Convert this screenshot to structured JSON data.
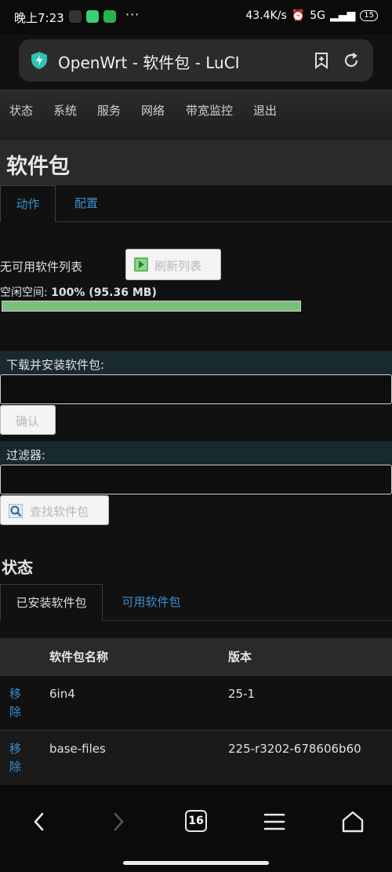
{
  "statusbar": {
    "time": "晚上7:23",
    "dots": "···",
    "net_speed": "43.4K/s",
    "signal": "5G",
    "battery": "15"
  },
  "browser": {
    "title": "OpenWrt - 软件包 - LuCI",
    "tab_count": "16"
  },
  "nav": {
    "items": [
      "状态",
      "系统",
      "服务",
      "网络",
      "带宽监控",
      "退出"
    ]
  },
  "page": {
    "title": "软件包",
    "tabs": [
      "动作",
      "配置"
    ]
  },
  "actions": {
    "list_label": "无可用软件列表",
    "refresh_button": "刷新列表",
    "free_space_label": "空闲空间:",
    "free_space_value": "100% (95.36 MB)",
    "free_space_percent": 100,
    "install_label": "下载并安装软件包:",
    "install_value": "",
    "confirm_button": "确认",
    "filter_label": "过滤器:",
    "filter_value": "",
    "find_button": "查找软件包"
  },
  "status": {
    "title": "状态",
    "tabs": [
      "已安装软件包",
      "可用软件包"
    ],
    "columns": [
      "软件包名称",
      "版本"
    ],
    "remove_label": "移除",
    "rows": [
      {
        "name": "6in4",
        "version": "25-1"
      },
      {
        "name": "base-files",
        "version": "225-r3202-678606b60"
      }
    ]
  },
  "colors": {
    "link": "#3a8fd0",
    "progress": "#7cbf7c",
    "shield": "#2ec4b6"
  }
}
